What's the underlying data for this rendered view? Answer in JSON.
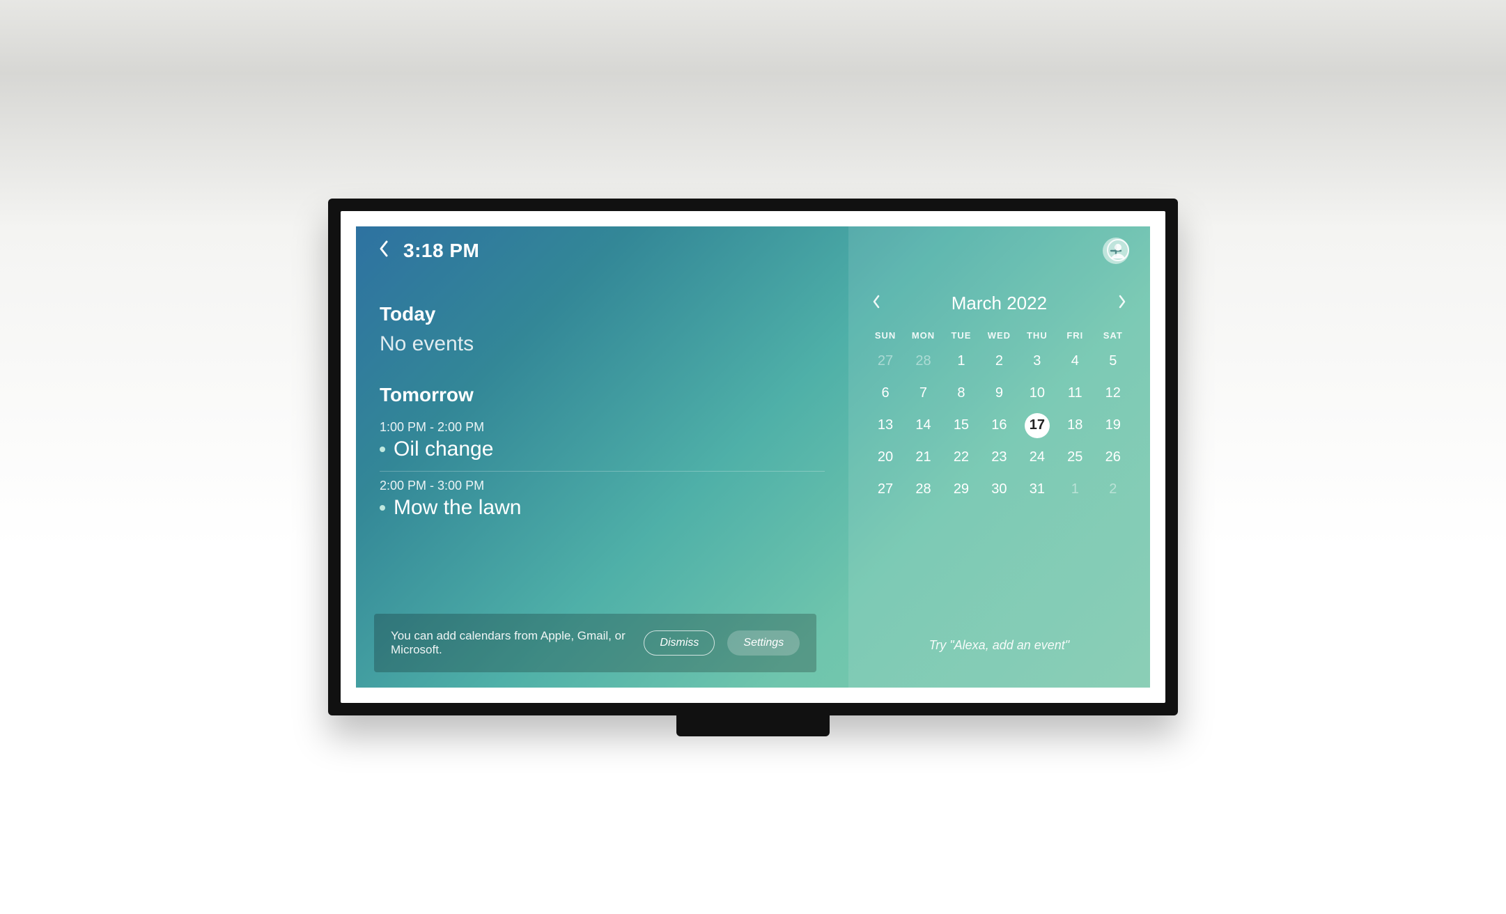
{
  "topbar": {
    "time": "3:18 PM"
  },
  "sections": [
    {
      "title": "Today",
      "empty_text": "No events",
      "events": []
    },
    {
      "title": "Tomorrow",
      "empty_text": "",
      "events": [
        {
          "time": "1:00 PM - 2:00 PM",
          "title": "Oil change"
        },
        {
          "time": "2:00 PM - 3:00 PM",
          "title": "Mow the lawn"
        }
      ]
    }
  ],
  "tip": {
    "text": "You can add calendars from Apple, Gmail, or Microsoft.",
    "dismiss": "Dismiss",
    "settings": "Settings"
  },
  "calendar": {
    "month_label": "March 2022",
    "dow": [
      "SUN",
      "MON",
      "TUE",
      "WED",
      "THU",
      "FRI",
      "SAT"
    ],
    "weeks": [
      [
        {
          "n": 27,
          "muted": true
        },
        {
          "n": 28,
          "muted": true
        },
        {
          "n": 1
        },
        {
          "n": 2
        },
        {
          "n": 3
        },
        {
          "n": 4
        },
        {
          "n": 5
        }
      ],
      [
        {
          "n": 6
        },
        {
          "n": 7
        },
        {
          "n": 8
        },
        {
          "n": 9
        },
        {
          "n": 10
        },
        {
          "n": 11
        },
        {
          "n": 12
        }
      ],
      [
        {
          "n": 13
        },
        {
          "n": 14
        },
        {
          "n": 15
        },
        {
          "n": 16
        },
        {
          "n": 17,
          "selected": true
        },
        {
          "n": 18
        },
        {
          "n": 19
        }
      ],
      [
        {
          "n": 20
        },
        {
          "n": 21
        },
        {
          "n": 22
        },
        {
          "n": 23
        },
        {
          "n": 24
        },
        {
          "n": 25
        },
        {
          "n": 26
        }
      ],
      [
        {
          "n": 27
        },
        {
          "n": 28
        },
        {
          "n": 29
        },
        {
          "n": 30
        },
        {
          "n": 31
        },
        {
          "n": 1,
          "muted": true
        },
        {
          "n": 2,
          "muted": true
        }
      ]
    ],
    "hint": "Try \"Alexa, add an event\""
  }
}
